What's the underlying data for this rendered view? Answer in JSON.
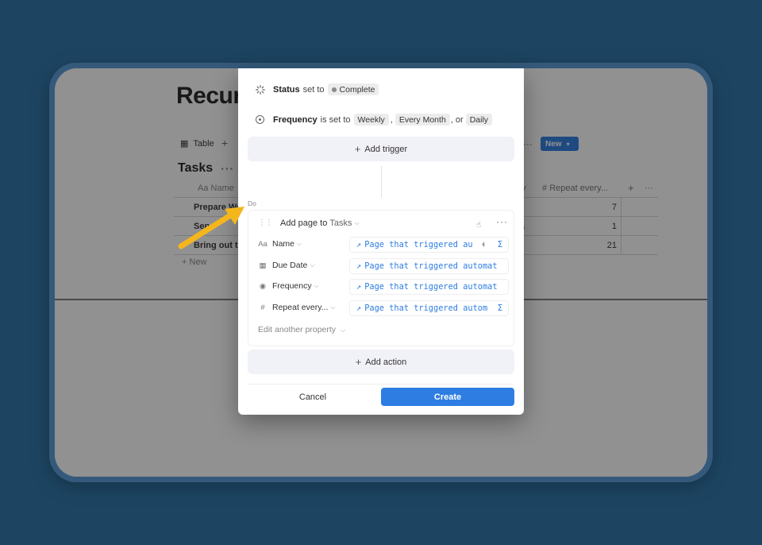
{
  "colors": {
    "backdrop": "#1d4562",
    "accent": "#2e7de2",
    "annotation_arrow": "#f4b61c"
  },
  "background_page": {
    "title": "Recur",
    "view_label": "Table",
    "database_title": "Tasks",
    "new_button": "New",
    "columns": {
      "name": "Name",
      "y_partial": "y",
      "repeat": "Repeat every..."
    },
    "rows": [
      {
        "name": "Prepare We",
        "repeat": "7"
      },
      {
        "name": "Send",
        "extra": "a",
        "repeat": "1"
      },
      {
        "name": "Bring out th",
        "repeat": "21"
      }
    ],
    "new_row_label": "New"
  },
  "modal": {
    "triggers": [
      {
        "icon": "status-icon",
        "property": "Status",
        "connector": "set to",
        "values": [
          "Complete"
        ]
      },
      {
        "icon": "frequency-icon",
        "property": "Frequency",
        "connector": "is set to",
        "values": [
          "Weekly",
          "Every Month",
          "Daily"
        ],
        "sep1": ",",
        "sep2": ", or"
      }
    ],
    "add_trigger_label": "Add trigger",
    "do_label": "Do",
    "action": {
      "verb": "Add page to",
      "target": "Tasks",
      "properties": [
        {
          "icon": "text-icon",
          "glyph": "Aa",
          "label": "Name",
          "value": "Page that triggered au",
          "tail_icon": "toggle-icon",
          "show_sigma": true
        },
        {
          "icon": "calendar-icon",
          "glyph": "▦",
          "label": "Due Date",
          "value": "Page that triggered automat",
          "show_sigma": false
        },
        {
          "icon": "frequency-icon",
          "glyph": "◉",
          "label": "Frequency",
          "value": "Page that triggered automat",
          "show_sigma": false
        },
        {
          "icon": "hash-icon",
          "glyph": "#",
          "label": "Repeat every...",
          "value": "Page that triggered autom",
          "show_sigma": true
        }
      ],
      "edit_another_label": "Edit another property"
    },
    "add_action_label": "Add action",
    "cancel_label": "Cancel",
    "create_label": "Create"
  }
}
